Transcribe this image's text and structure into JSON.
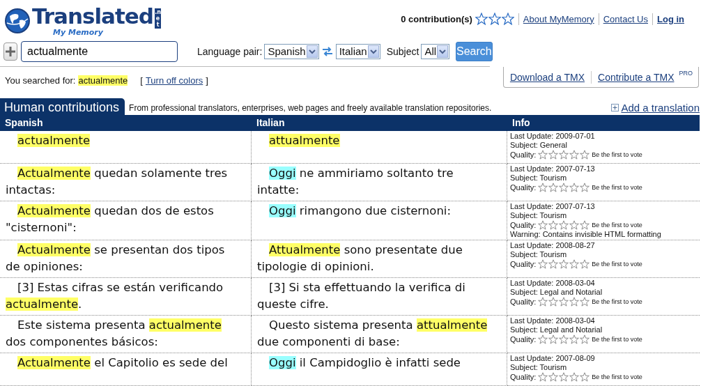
{
  "logo": {
    "title": "Translated",
    "tld": ".net",
    "subtitle": "My Memory"
  },
  "top_bar": {
    "contributions": "0 contribution(s)",
    "stars": 0,
    "links": [
      {
        "label": "About MyMemory",
        "bold": false
      },
      {
        "label": "Contact Us",
        "bold": false
      },
      {
        "label": "Log in",
        "bold": true
      }
    ]
  },
  "search": {
    "value": "actualmente",
    "language_pair_label": "Language pair:",
    "source_language": "Spanish",
    "target_language": "Italian",
    "subject_label": "Subject",
    "subject": "All",
    "button": "Search"
  },
  "searched": {
    "label": "You searched for:",
    "term": "actualmente",
    "open_bracket": "[",
    "toggle_link": "Turn off colors",
    "close_bracket": "]"
  },
  "tmx_links": [
    {
      "label": "Download a TMX"
    },
    {
      "label": "Contribute a TMX",
      "badge": "PRO"
    }
  ],
  "section": {
    "title": "Human contributions",
    "description": "From professional translators, enterprises, web pages and freely available translation repositories.",
    "add_link": "Add a translation"
  },
  "table": {
    "columns": [
      "Spanish",
      "Italian",
      "Info"
    ],
    "rows": [
      {
        "source": [
          {
            "text": "actualmente",
            "color": "#ffff66"
          }
        ],
        "target": [
          {
            "text": "attualmente",
            "color": "#ffff66"
          }
        ],
        "info": {
          "last_update": "Last Update: 2009-07-01",
          "subject": "Subject: General",
          "quality_label": "Quality:",
          "stars": 0,
          "vote": "Be the first to vote"
        }
      },
      {
        "source": [
          {
            "text": "Actualmente",
            "color": "#ffff66"
          },
          {
            "text": " quedan solamente tres intactas:"
          }
        ],
        "target": [
          {
            "text": "Oggi",
            "color": "#99ffff"
          },
          {
            "text": " ne ammiriamo soltanto tre intatte:"
          }
        ],
        "info": {
          "last_update": "Last Update: 2007-07-13",
          "subject": "Subject: Tourism",
          "quality_label": "Quality:",
          "stars": 0,
          "vote": "Be the first to vote"
        }
      },
      {
        "source": [
          {
            "text": "Actualmente",
            "color": "#ffff66"
          },
          {
            "text": " quedan dos de estos \"cisternoni\":"
          }
        ],
        "target": [
          {
            "text": "Oggi",
            "color": "#99ffff"
          },
          {
            "text": " rimangono due cisternoni:"
          }
        ],
        "info": {
          "last_update": "Last Update: 2007-07-13",
          "subject": "Subject: Tourism",
          "quality_label": "Quality:",
          "stars": 0,
          "vote": "Be the first to vote",
          "warning": "Warning: Contains invisible HTML formatting"
        }
      },
      {
        "source": [
          {
            "text": "Actualmente",
            "color": "#ffff66"
          },
          {
            "text": " se presentan dos tipos de opiniones:"
          }
        ],
        "target": [
          {
            "text": "Attualmente",
            "color": "#ffff66"
          },
          {
            "text": " sono presentate due tipologie di opinioni."
          }
        ],
        "info": {
          "last_update": "Last Update: 2008-08-27",
          "subject": "Subject: Tourism",
          "quality_label": "Quality:",
          "stars": 0,
          "vote": "Be the first to vote"
        }
      },
      {
        "source": [
          {
            "text": "[3] Estas cifras se están verificando "
          },
          {
            "text": "actualmente",
            "color": "#ffff66"
          },
          {
            "text": "."
          }
        ],
        "target": [
          {
            "text": "[3] Si sta effettuando la verifica di queste cifre."
          }
        ],
        "info": {
          "last_update": "Last Update: 2008-03-04",
          "subject": "Subject: Legal and Notarial",
          "quality_label": "Quality:",
          "stars": 0,
          "vote": "Be the first to vote"
        }
      },
      {
        "source": [
          {
            "text": "Este sistema presenta "
          },
          {
            "text": "actualmente",
            "color": "#ffff66"
          },
          {
            "text": " dos componentes básicos:"
          }
        ],
        "target": [
          {
            "text": "Questo sistema presenta "
          },
          {
            "text": "attualmente",
            "color": "#ffff66"
          },
          {
            "text": " due componenti di base:"
          }
        ],
        "info": {
          "last_update": "Last Update: 2008-03-04",
          "subject": "Subject: Legal and Notarial",
          "quality_label": "Quality:",
          "stars": 0,
          "vote": "Be the first to vote"
        }
      },
      {
        "source": [
          {
            "text": "Actualmente",
            "color": "#ffff66"
          },
          {
            "text": " el Capitolio es sede del"
          }
        ],
        "target": [
          {
            "text": "Oggi",
            "color": "#99ffff"
          },
          {
            "text": " il Campidoglio è infatti sede"
          }
        ],
        "info": {
          "last_update": "Last Update: 2007-08-09",
          "subject": "Subject: Tourism",
          "quality_label": "Quality:",
          "stars": 0,
          "vote": "Be the first to vote"
        }
      }
    ]
  }
}
